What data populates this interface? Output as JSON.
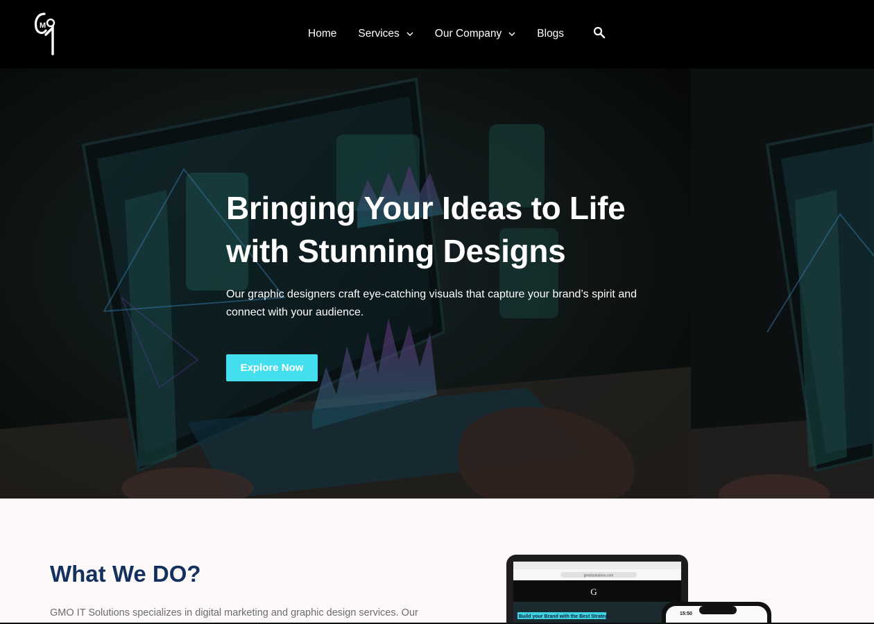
{
  "nav": {
    "logo_text": "GMO",
    "items": [
      {
        "label": "Home",
        "has_dropdown": false
      },
      {
        "label": "Services",
        "has_dropdown": true
      },
      {
        "label": "Our Company",
        "has_dropdown": true
      },
      {
        "label": "Blogs",
        "has_dropdown": false
      }
    ],
    "search_icon": "search-icon"
  },
  "hero": {
    "title_line1": "Bringing Your Ideas to Life",
    "title_line2": "with Stunning Designs",
    "subtitle_line1": "Our graphic designers craft eye-catching visuals that capture your brand’s spirit and",
    "subtitle_line2": "connect with your audience.",
    "cta_label": "Explore Now",
    "accent_color": "#44dfee",
    "background_image": "laptop-with-dashboard-ui-photo"
  },
  "what_we_do": {
    "title": "What We DO?",
    "text": "GMO IT Solutions specializes in digital marketing and graphic design services. Our",
    "device_banner": "Build your Brand with the Best Strategy",
    "phone_time": "15:50",
    "tablet_url": "gmoitsolutions.com"
  },
  "colors": {
    "nav_bg": "#000000",
    "title_color": "#13305f",
    "page_bg": "#fbf8f7"
  }
}
